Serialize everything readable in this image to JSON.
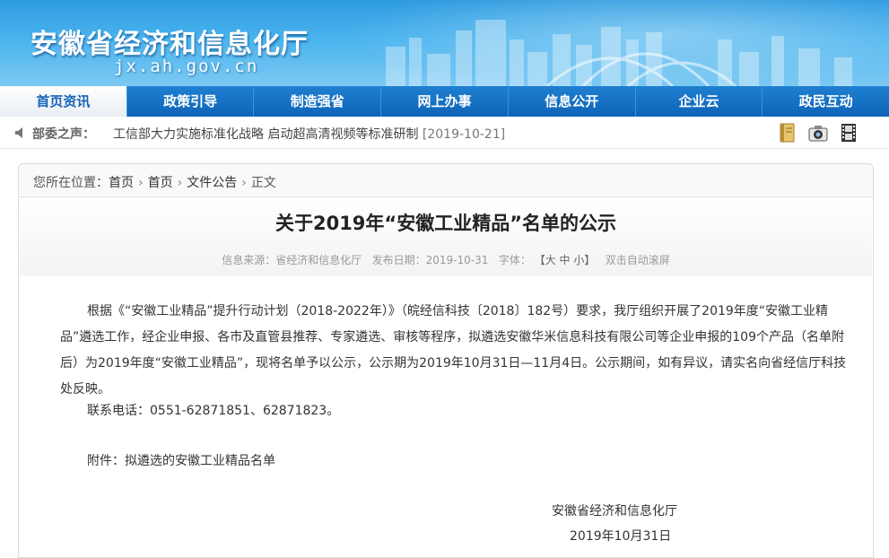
{
  "header": {
    "title": "安徽省经济和信息化厅",
    "domain": "jx.ah.gov.cn"
  },
  "nav": {
    "items": [
      "首页资讯",
      "政策引导",
      "制造强省",
      "网上办事",
      "信息公开",
      "企业云",
      "政民互动"
    ],
    "active_index": 0
  },
  "ticker": {
    "label": "部委之声：",
    "item_text": "工信部大力实施标准化战略 启动超高清视频等标准研制",
    "item_date": "[2019-10-21]"
  },
  "toolbar": {
    "icons": [
      "notebook-icon",
      "camera-icon",
      "film-icon"
    ]
  },
  "breadcrumb": {
    "prefix": "您所在位置：",
    "items": [
      "首页",
      "首页",
      "文件公告",
      "正文"
    ],
    "separator": "›"
  },
  "article": {
    "title": "关于2019年“安徽工业精品”名单的公示",
    "meta_source": "信息来源：省经济和信息化厅",
    "meta_date": "发布日期：2019-10-31",
    "meta_font_label": "字体：",
    "meta_font_sizes": "【大 中 小】",
    "meta_scroll": "双击自动滚屏",
    "paragraph1": "根据《“安徽工业精品”提升行动计划（2018-2022年）》（皖经信科技〔2018〕182号）要求，我厅组织开展了2019年度“安徽工业精品”遴选工作，经企业申报、各市及直管县推荐、专家遴选、审核等程序，拟遴选安徽华米信息科技有限公司等企业申报的109个产品（名单附后）为2019年度“安徽工业精品”，现将名单予以公示，公示期为2019年10月31日—11月4日。公示期间，如有异议，请实名向省经信厅科技处反映。",
    "contact": "联系电话：0551-62871851、62871823。",
    "attachment": "附件：拟遴选的安徽工业精品名单",
    "signature_org": "安徽省经济和信息化厅",
    "signature_date": "2019年10月31日"
  },
  "colors": {
    "banner_top": "#2f9be0",
    "nav_blue": "#0e64b8",
    "active_text": "#1565b5"
  }
}
